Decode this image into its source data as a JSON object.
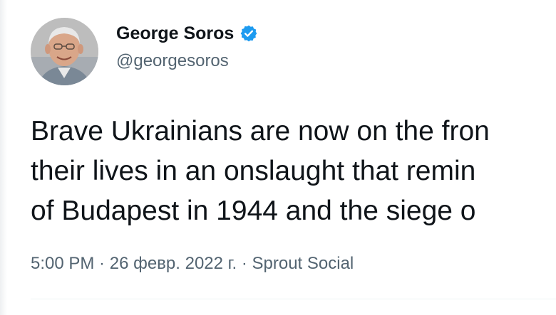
{
  "author": {
    "display_name": "George Soros",
    "handle": "@georgesoros",
    "verified": true,
    "verified_icon": "verified-badge-icon",
    "verified_color": "#1d9bf0"
  },
  "tweet": {
    "lines": [
      "Brave Ukrainians are now on the fron",
      "their lives in an onslaught that remin",
      "of Budapest in 1944 and the siege o"
    ]
  },
  "meta": {
    "time": "5:00 PM",
    "separator": " · ",
    "date": "26 февр. 2022 г.",
    "source": "Sprout Social"
  },
  "colors": {
    "text_primary": "#0f1419",
    "text_secondary": "#536471"
  }
}
